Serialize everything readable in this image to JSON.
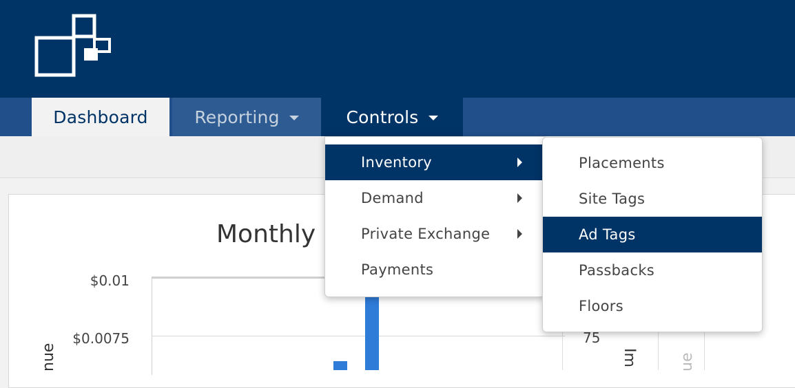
{
  "nav": {
    "tabs": [
      {
        "label": "Dashboard"
      },
      {
        "label": "Reporting"
      },
      {
        "label": "Controls"
      }
    ]
  },
  "controls_menu": {
    "items": [
      {
        "label": "Inventory",
        "has_submenu": true,
        "active": true
      },
      {
        "label": "Demand",
        "has_submenu": true,
        "active": false
      },
      {
        "label": "Private Exchange",
        "has_submenu": true,
        "active": false
      },
      {
        "label": "Payments",
        "has_submenu": false,
        "active": false
      }
    ]
  },
  "inventory_submenu": {
    "items": [
      {
        "label": "Placements",
        "active": false
      },
      {
        "label": "Site Tags",
        "active": false
      },
      {
        "label": "Ad Tags",
        "active": true
      },
      {
        "label": "Passbacks",
        "active": false
      },
      {
        "label": "Floors",
        "active": false
      }
    ]
  },
  "chart": {
    "title_visible": "Monthly N",
    "y_ticks": [
      "$0.01",
      "$0.0075"
    ],
    "y_axis_label_partial": "nue",
    "right_tick": "75",
    "right_axis_label_partial": "Im",
    "far_right_label_partial": "ue"
  },
  "colors": {
    "brand_dark": "#003366",
    "nav_bar": "#214f8a",
    "bar": "#2e7bd8"
  }
}
